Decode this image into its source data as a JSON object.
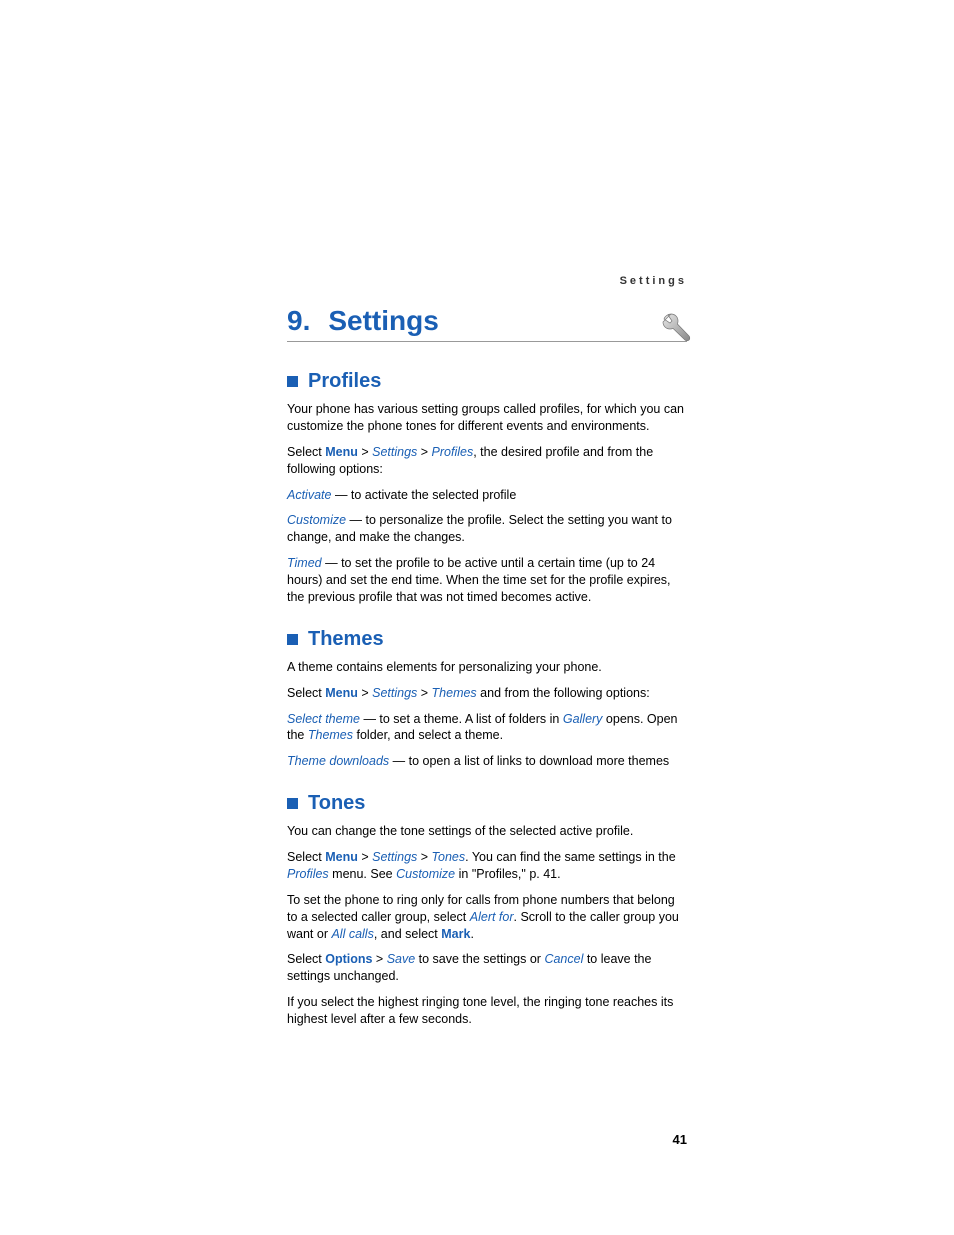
{
  "header": {
    "running": "Settings"
  },
  "chapter": {
    "number": "9.",
    "title": "Settings"
  },
  "sections": {
    "profiles": {
      "title": "Profiles",
      "intro": "Your phone has various setting groups called profiles, for which you can customize the phone tones for different events and environments.",
      "path": {
        "select": "Select ",
        "menu": "Menu",
        "sep": " > ",
        "settings": "Settings",
        "profiles": "Profiles",
        "tail": ", the desired profile and from the following options:"
      },
      "activate": {
        "term": "Activate",
        "desc": " — to activate the selected profile"
      },
      "customize": {
        "term": "Customize",
        "desc": " — to personalize the profile. Select the setting you want to change, and make the changes."
      },
      "timed": {
        "term": "Timed",
        "desc": " — to set the profile to be active until a certain time (up to 24 hours) and set the end time. When the time set for the profile expires, the previous profile that was not timed becomes active."
      }
    },
    "themes": {
      "title": "Themes",
      "intro": "A theme contains elements for personalizing your phone.",
      "path": {
        "select": "Select ",
        "menu": "Menu",
        "sep": " > ",
        "settings": "Settings",
        "themes": "Themes",
        "tail": " and from the following options:"
      },
      "select_theme": {
        "term": "Select theme",
        "pre": " — to set a theme. A list of folders in ",
        "gallery": "Gallery",
        "mid": " opens. Open the ",
        "themes": "Themes",
        "post": " folder, and select a theme."
      },
      "downloads": {
        "term": "Theme downloads",
        "desc": " — to open a list of links to download more themes"
      }
    },
    "tones": {
      "title": "Tones",
      "intro": "You can change the tone settings of the selected active profile.",
      "path": {
        "select": "Select ",
        "menu": "Menu",
        "sep": " > ",
        "settings": "Settings",
        "tones": "Tones",
        "mid": ". You can find the same settings in the ",
        "profiles": "Profiles",
        "see1": " menu. See ",
        "customize": "Customize",
        "see2": " in \"Profiles,\" p. 41."
      },
      "ring": {
        "pre": "To set the phone to ring only for calls from phone numbers that belong to a selected caller group, select ",
        "alertfor": "Alert for",
        "mid": ". Scroll to the caller group you want or ",
        "allcalls": "All calls",
        "post1": ", and select ",
        "mark": "Mark",
        "post2": "."
      },
      "save": {
        "select": "Select ",
        "options": "Options",
        "sep": " > ",
        "save": "Save",
        "mid": " to save the settings or ",
        "cancel": "Cancel",
        "post": " to leave the settings unchanged."
      },
      "note": "If you select the highest ringing tone level, the ringing tone reaches its highest level after a few seconds."
    }
  },
  "page_number": "41"
}
